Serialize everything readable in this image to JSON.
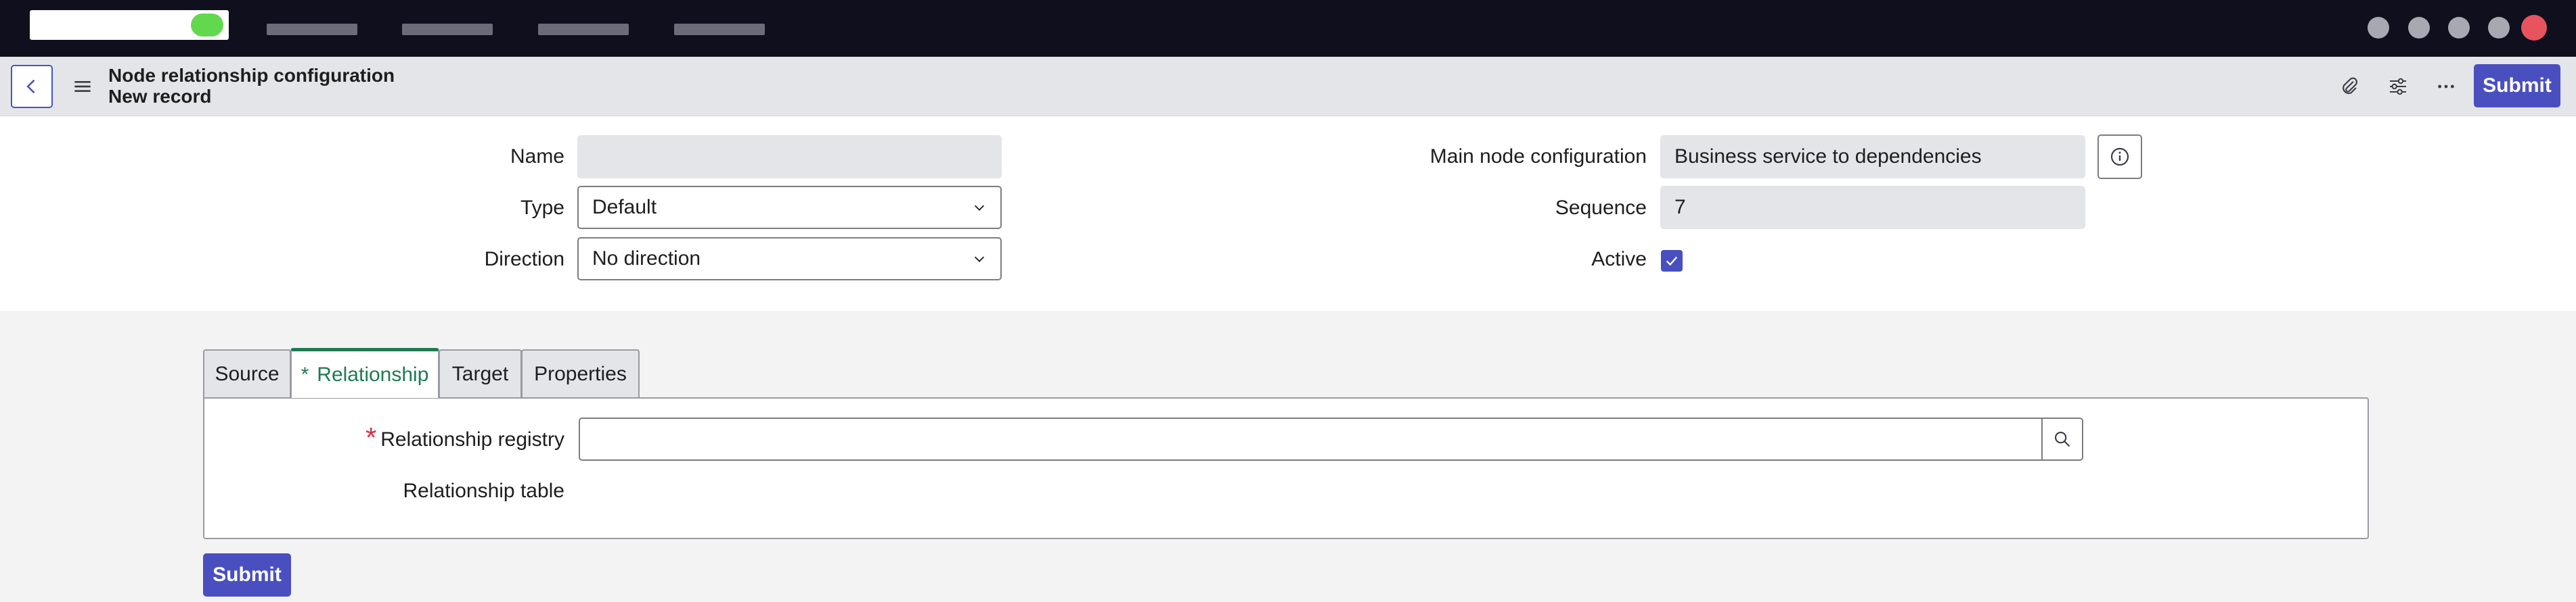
{
  "header": {
    "title": "Node relationship configuration",
    "subtitle": "New record",
    "submit_label": "Submit"
  },
  "form": {
    "name": {
      "label": "Name",
      "value": ""
    },
    "type": {
      "label": "Type",
      "value": "Default"
    },
    "direction": {
      "label": "Direction",
      "value": "No direction"
    },
    "main_node_configuration": {
      "label": "Main node configuration",
      "value": "Business service to dependencies"
    },
    "sequence": {
      "label": "Sequence",
      "value": "7"
    },
    "active": {
      "label": "Active",
      "checked": true
    }
  },
  "tabs": [
    {
      "label": "Source",
      "active": false
    },
    {
      "label": "Relationship",
      "active": true,
      "marker": "*"
    },
    {
      "label": "Target",
      "active": false
    },
    {
      "label": "Properties",
      "active": false
    }
  ],
  "relationship_tab": {
    "relationship_registry_label": "Relationship registry",
    "relationship_registry_value": "",
    "required_marker": "*",
    "relationship_table_label": "Relationship table"
  },
  "footer": {
    "submit_label": "Submit"
  },
  "colors": {
    "topnav_bg": "#0f0f1d",
    "primary": "#4a4fc0",
    "active_tab": "#1f7a52",
    "required": "#d13349",
    "status_green": "#62d84e",
    "close_red": "#e8535e"
  },
  "icons": {
    "back": "chevron-left-icon",
    "menu": "hamburger-icon",
    "attachment": "paperclip-icon",
    "personalize": "sliders-icon",
    "more": "ellipsis-icon",
    "info": "info-icon",
    "lookup": "search-icon",
    "checkbox": "check-icon"
  }
}
